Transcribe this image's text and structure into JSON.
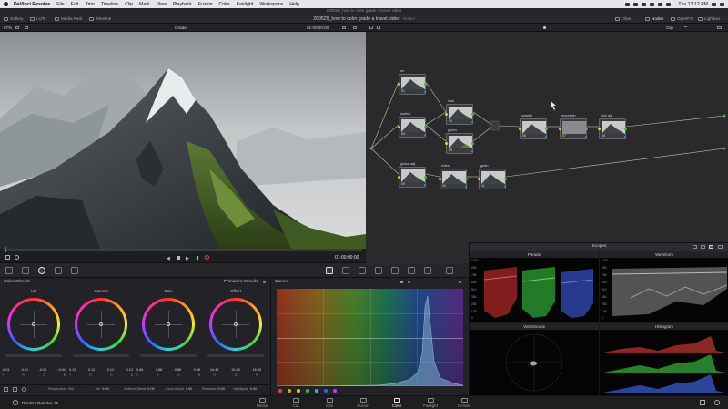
{
  "menubar": {
    "items": [
      "DaVinci Resolve",
      "File",
      "Edit",
      "Trim",
      "Timeline",
      "Clip",
      "Mark",
      "View",
      "Playback",
      "Fusion",
      "Color",
      "Fairlight",
      "Workspace",
      "Help"
    ],
    "clock": "Thu 12:12 PM"
  },
  "window_title": "200529_how to color grade a travel video",
  "toolbar": {
    "gallery": "Gallery",
    "luts": "LUTs",
    "media_pool": "Media Pool",
    "timeline": "Timeline",
    "project_title": "200529_how to color grade a travel video",
    "edited": "Edited",
    "clips": "Clips",
    "nodes": "Nodes",
    "openfx": "OpenFX",
    "lightbox": "Lightbox"
  },
  "viewer": {
    "zoom": "67%",
    "grade_label": "Grade",
    "timecode_top": "01:00:00:00",
    "timecode": "01:00:00:00"
  },
  "node_editor": {
    "clip_label": "Clip",
    "nodes": [
      {
        "id": "n-01",
        "label": "wr",
        "num": "01"
      },
      {
        "id": "n-02",
        "label": "warhol",
        "num": "02"
      },
      {
        "id": "n-03",
        "label": "look",
        "num": "03"
      },
      {
        "id": "n-05",
        "label": "green",
        "num": "05"
      },
      {
        "id": "n-06",
        "label": "outside",
        "num": "06"
      },
      {
        "id": "n-07",
        "label": "mountain",
        "num": "07"
      },
      {
        "id": "n-08",
        "label": "look adj",
        "num": "08"
      },
      {
        "id": "n-09",
        "label": "global adj",
        "num": "09"
      },
      {
        "id": "n-10",
        "label": "extra",
        "num": "10"
      },
      {
        "id": "n-11",
        "label": "grain",
        "num": "11"
      }
    ]
  },
  "color_wheels": {
    "title": "Color Wheels",
    "mode": "Primaries Wheels",
    "wheels": [
      {
        "name": "Lift",
        "values": [
          "-0.01",
          "-0.01",
          "-0.01",
          "-0.01"
        ],
        "channels": [
          "Y",
          "R",
          "G",
          "B"
        ]
      },
      {
        "name": "Gamma",
        "values": [
          "0.12",
          "0.12",
          "0.12",
          "0.12"
        ],
        "channels": [
          "Y",
          "R",
          "G",
          "B"
        ]
      },
      {
        "name": "Gain",
        "values": [
          "0.88",
          "0.88",
          "0.88",
          "0.88"
        ],
        "channels": [
          "Y",
          "R",
          "G",
          "B"
        ]
      },
      {
        "name": "Offset",
        "values": [
          "16.45",
          "16.45",
          "16.45"
        ],
        "channels": [
          "R",
          "G",
          "B"
        ]
      }
    ],
    "adjust": [
      {
        "label": "Temperature",
        "value": "0.0"
      },
      {
        "label": "Tint",
        "value": "0.00"
      },
      {
        "label": "Midtone Detail",
        "value": "0.00"
      },
      {
        "label": "Color Boost",
        "value": "0.00"
      },
      {
        "label": "Shadows",
        "value": "0.00"
      },
      {
        "label": "Highlights",
        "value": "0.00"
      }
    ]
  },
  "curves": {
    "title": "Curves"
  },
  "scopes": {
    "title": "Scopes",
    "parade_label": "Parade",
    "waveform_label": "Waveform",
    "vectorscope_label": "Vectorscope",
    "histogram_label": "Histogram",
    "scale": [
      "1023",
      "896",
      "768",
      "640",
      "512",
      "384",
      "256",
      "128",
      "0"
    ]
  },
  "pages": [
    "Media",
    "Cut",
    "Edit",
    "Fusion",
    "Color",
    "Fairlight",
    "Deliver"
  ],
  "active_page": "Color",
  "app_version": "DaVinci Resolve 16",
  "colors": {
    "accent": "#e04848",
    "node_pin_in": "#e6c84a",
    "node_pin_out": "#52b04a",
    "node_pin_key": "#4a7fe0"
  }
}
